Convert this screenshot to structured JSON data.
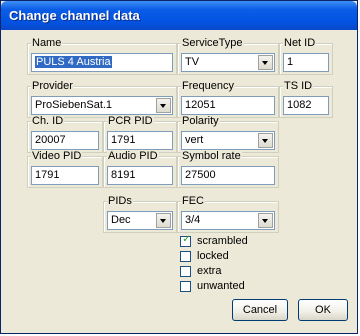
{
  "window": {
    "title": "Change channel data"
  },
  "fields": {
    "name": {
      "label": "Name",
      "value": "PULS 4 Austria"
    },
    "service_type": {
      "label": "ServiceType",
      "value": "TV"
    },
    "net_id": {
      "label": "Net ID",
      "value": "1"
    },
    "provider": {
      "label": "Provider",
      "value": "ProSiebenSat.1"
    },
    "frequency": {
      "label": "Frequency",
      "value": "12051"
    },
    "ts_id": {
      "label": "TS ID",
      "value": "1082"
    },
    "ch_id": {
      "label": "Ch. ID",
      "value": "20007"
    },
    "pcr_pid": {
      "label": "PCR PID",
      "value": "1791"
    },
    "polarity": {
      "label": "Polarity",
      "value": "vert"
    },
    "video_pid": {
      "label": "Video PID",
      "value": "1791"
    },
    "audio_pid": {
      "label": "Audio PID",
      "value": "8191"
    },
    "symbol_rate": {
      "label": "Symbol rate",
      "value": "27500"
    },
    "pids": {
      "label": "PIDs",
      "value": "Dec"
    },
    "fec": {
      "label": "FEC",
      "value": "3/4"
    }
  },
  "checkboxes": {
    "scrambled": {
      "label": "scrambled",
      "checked": true,
      "mark": "✓"
    },
    "locked": {
      "label": "locked",
      "checked": false
    },
    "extra": {
      "label": "extra",
      "checked": false
    },
    "unwanted": {
      "label": "unwanted",
      "checked": false
    }
  },
  "buttons": {
    "cancel": "Cancel",
    "ok": "OK"
  }
}
